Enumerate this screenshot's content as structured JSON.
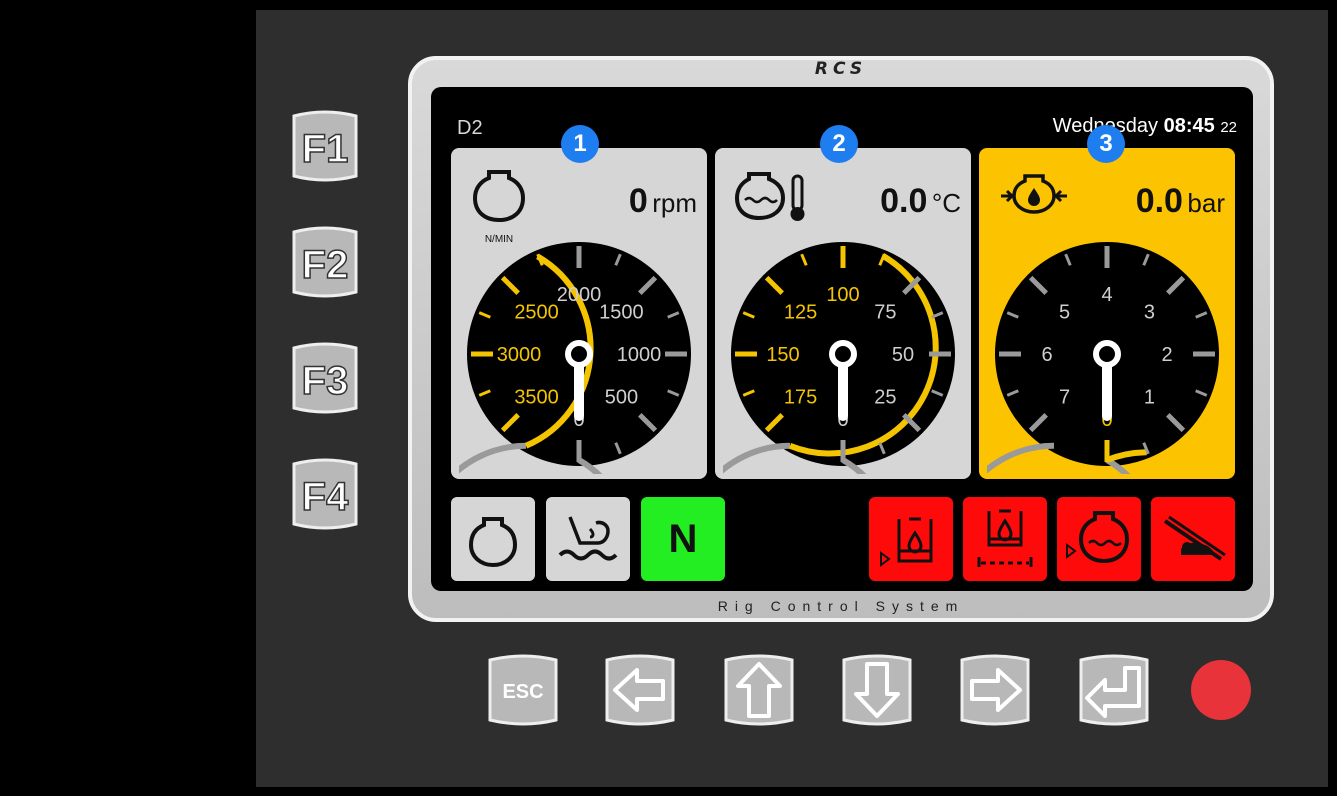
{
  "device": {
    "brand": "RCS",
    "subtitle": "Rig Control System"
  },
  "function_keys": [
    "F1",
    "F2",
    "F3",
    "F4"
  ],
  "screen": {
    "page_id": "D2",
    "date_prefix": "Wednesday",
    "time": "08:45",
    "time_suffix": "22"
  },
  "gauges": [
    {
      "badge": "1",
      "value": "0",
      "unit": "rpm",
      "sub_label": "N/MIN",
      "ticks": [
        "0",
        "500",
        "1000",
        "1500",
        "2000",
        "2500",
        "3000",
        "3500"
      ],
      "highlight_from": 5,
      "needle": "0",
      "bg": "#d6d6d6",
      "accent": "#f5c400"
    },
    {
      "badge": "2",
      "value": "0.0",
      "unit": "°C",
      "ticks": [
        "0",
        "25",
        "50",
        "75",
        "100",
        "125",
        "150",
        "175"
      ],
      "highlight_from": 4,
      "needle": "0",
      "bg": "#d6d6d6",
      "accent": "#f5c400"
    },
    {
      "badge": "3",
      "value": "0.0",
      "unit": "bar",
      "ticks": [
        "0",
        "1",
        "2",
        "3",
        "4",
        "5",
        "6",
        "7"
      ],
      "highlight_from": 8,
      "needle": "0",
      "bg": "#fcc400",
      "accent": "#f5c400"
    }
  ],
  "status_buttons": {
    "neutral_label": "N",
    "engine_color": "#d6d6d6",
    "neutral_color": "#22ee22",
    "alarm_color": "#ff0a0a"
  },
  "nav_keys": {
    "esc_label": "ESC"
  }
}
